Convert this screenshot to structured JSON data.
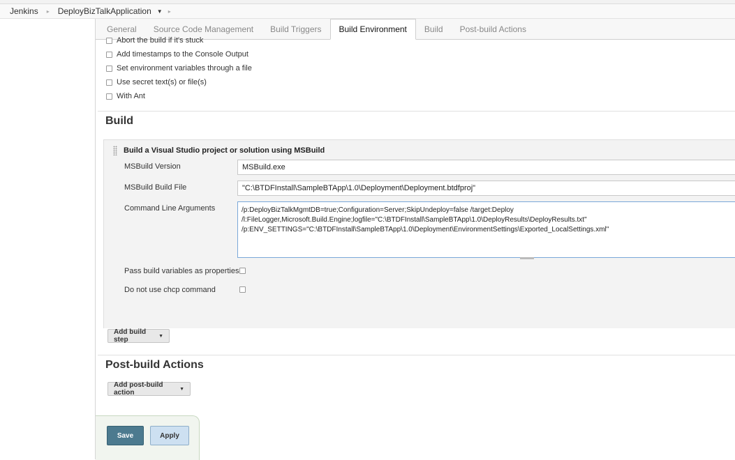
{
  "breadcrumb": {
    "root": "Jenkins",
    "job": "DeployBizTalkApplication"
  },
  "tabs": [
    {
      "label": "General"
    },
    {
      "label": "Source Code Management"
    },
    {
      "label": "Build Triggers"
    },
    {
      "label": "Build Environment"
    },
    {
      "label": "Build"
    },
    {
      "label": "Post-build Actions"
    }
  ],
  "build_environment": {
    "options": [
      {
        "label": "Abort the build if it's stuck",
        "checked": false
      },
      {
        "label": "Add timestamps to the Console Output",
        "checked": false
      },
      {
        "label": "Set environment variables through a file",
        "checked": false
      },
      {
        "label": "Use secret text(s) or file(s)",
        "checked": false
      },
      {
        "label": "With Ant",
        "checked": false
      }
    ]
  },
  "build": {
    "title": "Build",
    "step_title": "Build a Visual Studio project or solution using MSBuild",
    "msbuild_version_label": "MSBuild Version",
    "msbuild_version_value": "MSBuild.exe",
    "build_file_label": "MSBuild Build File",
    "build_file_value": "\"C:\\BTDFInstall\\SampleBTApp\\1.0\\Deployment\\Deployment.btdfproj\"",
    "cmd_args_label": "Command Line Arguments",
    "cmd_args_lines": [
      "/p:DeployBizTalkMgmtDB=true;Configuration=Server;SkipUndeploy=false /target:Deploy",
      "/l:FileLogger,Microsoft.Build.Engine;logfile=\"C:\\BTDFInstall\\SampleBTApp\\1.0\\DeployResults\\DeployResults.txt\"",
      "/p:ENV_SETTINGS=\"C:\\BTDFInstall\\SampleBTApp\\1.0\\Deployment\\EnvironmentSettings\\Exported_LocalSettings.xml\""
    ],
    "pass_build_vars_label": "Pass build variables as properties",
    "no_chcp_label": "Do not use chcp command",
    "add_build_step_label": "Add build step"
  },
  "post_build": {
    "title": "Post-build Actions",
    "add_action_label": "Add post-build action"
  },
  "footer": {
    "save_label": "Save",
    "apply_label": "Apply"
  }
}
